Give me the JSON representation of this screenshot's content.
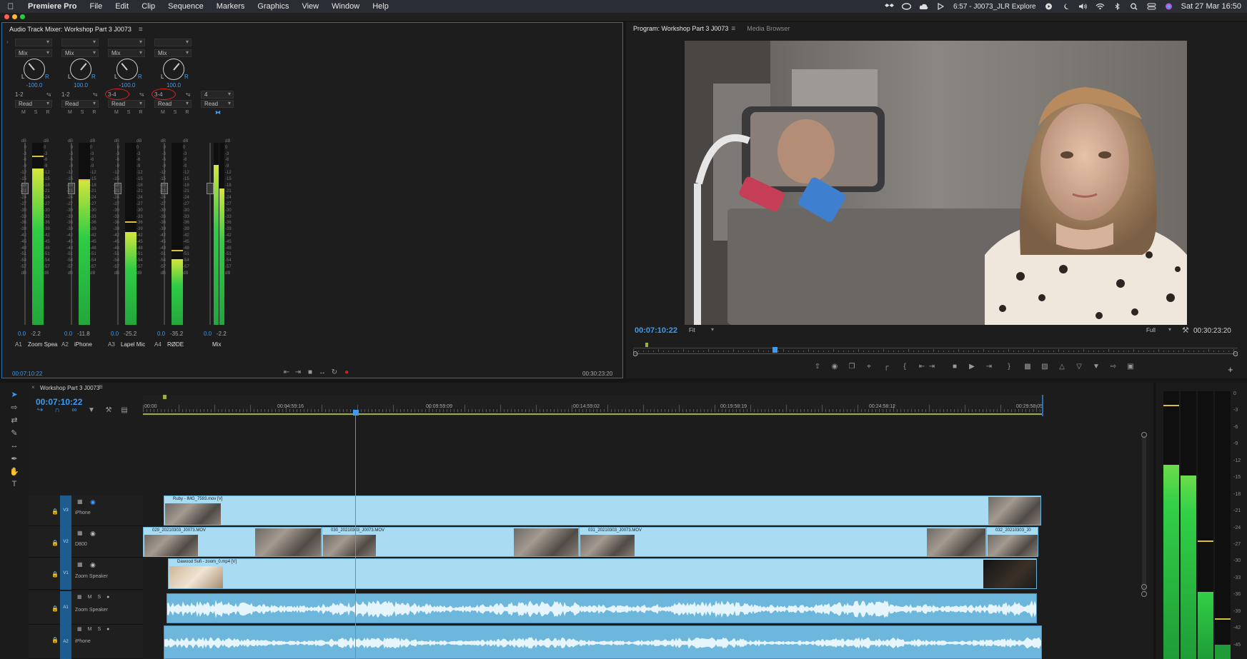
{
  "menubar": {
    "app_name": "Premiere Pro",
    "items": [
      "File",
      "Edit",
      "Clip",
      "Sequence",
      "Markers",
      "Graphics",
      "View",
      "Window",
      "Help"
    ],
    "status_text": "6:57 - J0073_JLR Explore",
    "datetime": "Sat 27 Mar  16:50"
  },
  "mixer": {
    "title": "Audio Track Mixer: Workshop Part 3 J0073",
    "timecode_left": "00:07:10:22",
    "timecode_right": "00:30:23:20",
    "channels": [
      {
        "mode": "Mix",
        "pan_value": "-100.0",
        "routing": "1-2",
        "automation": "Read",
        "vol": "0.0",
        "peak": "-2.2",
        "track": "A1",
        "name": "Zoom Spea",
        "level": 0.86,
        "peak_marker": 0.93
      },
      {
        "mode": "Mix",
        "pan_value": "100.0",
        "routing": "1-2",
        "automation": "Read",
        "vol": "0.0",
        "peak": "-11.8",
        "track": "A2",
        "name": "iPhone",
        "level": 0.8,
        "peak_marker": 0.8
      },
      {
        "mode": "Mix",
        "pan_value": "-100.0",
        "routing": "3-4",
        "automation": "Read",
        "vol": "0.0",
        "peak": "-25.2",
        "track": "A3",
        "name": "Lapel Mic",
        "level": 0.51,
        "peak_marker": 0.57
      },
      {
        "mode": "Mix",
        "pan_value": "100.0",
        "routing": "3-4",
        "automation": "Read",
        "vol": "0.0",
        "peak": "-35.2",
        "track": "A4",
        "name": "RØDE",
        "level": 0.36,
        "peak_marker": 0.41
      }
    ],
    "master": {
      "routing": "4",
      "automation": "Read",
      "vol": "0.0",
      "peak": "-2.2",
      "name": "Mix",
      "level": 0.88
    },
    "db_scale": [
      "dB",
      "0",
      "-3",
      "-6",
      "-9",
      "-12",
      "-15",
      "-18",
      "-21",
      "-24",
      "-27",
      "-30",
      "-33",
      "-36",
      "-39",
      "-42",
      "-45",
      "-48",
      "-51",
      "-54",
      "-57",
      "dB"
    ],
    "msr_label": "M S R"
  },
  "program": {
    "tab_title": "Program: Workshop Part 3 J0073",
    "tab_media": "Media Browser",
    "timecode": "00:07:10:22",
    "fit": "Fit",
    "resolution": "Full",
    "duration": "00:30:23:20",
    "playhead_fraction": 0.23
  },
  "timeline": {
    "title": "Workshop Part 3 J0073",
    "timecode": "00:07:10:22",
    "ruler": [
      "00:00",
      "00:04:59:16",
      "00:09:59:09",
      "00:14:59:02",
      "00:19:58:19",
      "00:24:58:12",
      "00:29:58:05"
    ],
    "tracks": {
      "v3": {
        "tag": "V3",
        "name": "iPhone"
      },
      "v2": {
        "tag": "V2",
        "name": "D800"
      },
      "v1": {
        "tag": "V1",
        "name": "Zoom Speaker"
      },
      "a1": {
        "tag": "A1",
        "name": "Zoom Speaker"
      },
      "a2": {
        "tag": "A2",
        "name": "iPhone"
      }
    },
    "clips": {
      "v3": "Ruby - IMG_7593.mov [V]",
      "v2a": "029_20210303_J0073.MOV",
      "v2b": "030_20210303_J0073.MOV",
      "v2c": "031_20210303_J0073.MOV",
      "v2d": "032_20210303_J0",
      "v1": "Dawood Sufi - zoom_0.mp4 [V]"
    },
    "meter_scale": [
      "0",
      "-3",
      "-6",
      "-9",
      "-12",
      "-15",
      "-18",
      "-21",
      "-24",
      "-27",
      "-30",
      "-33",
      "-36",
      "-39",
      "-42",
      "-45"
    ]
  },
  "colors": {
    "accent_blue": "#3b9cf5",
    "clip_blue": "#a9dcf3",
    "meter_green": "#2fcc45",
    "annotation_red": "#e02020"
  }
}
